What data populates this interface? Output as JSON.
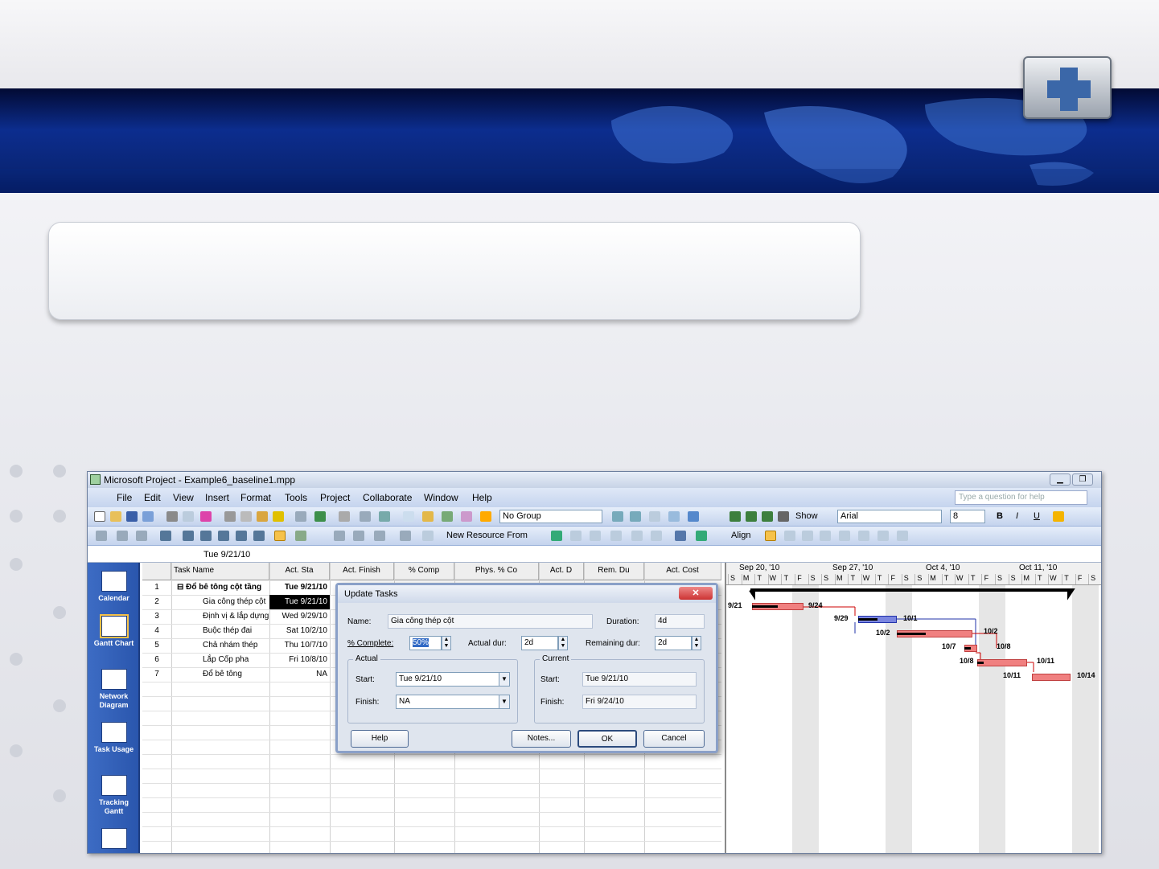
{
  "window": {
    "title": "Microsoft Project - Example6_baseline1.mpp"
  },
  "menu": [
    "File",
    "Edit",
    "View",
    "Insert",
    "Format",
    "Tools",
    "Project",
    "Collaborate",
    "Window",
    "Help"
  ],
  "help_search": {
    "placeholder": "Type a question for help"
  },
  "toolbar1": {
    "group_combo": "No Group",
    "show_label": "Show",
    "font_combo": "Arial",
    "size_combo": "8",
    "bold": "B",
    "italic": "I",
    "underline": "U"
  },
  "toolbar2": {
    "new_resource": "New Resource From",
    "align": "Align"
  },
  "edit_bar": {
    "value": "Tue 9/21/10"
  },
  "view_bar": [
    {
      "label": "Calendar"
    },
    {
      "label": "Gantt Chart"
    },
    {
      "label": "Network Diagram"
    },
    {
      "label": "Task Usage"
    },
    {
      "label": "Tracking Gantt"
    }
  ],
  "table": {
    "columns": [
      "Task Name",
      "Act. Sta",
      "Act. Finish",
      "% Comp",
      "Phys. % Co",
      "Act. D",
      "Rem. Du",
      "Act. Cost"
    ],
    "rows": [
      {
        "id": "1",
        "name": "Đổ bê tông cột tầng",
        "start": "Tue 9/21/10"
      },
      {
        "id": "2",
        "name": "Gia công thép cột",
        "start": "Tue 9/21/10"
      },
      {
        "id": "3",
        "name": "Định vị & lắp dựng",
        "start": "Wed 9/29/10"
      },
      {
        "id": "4",
        "name": "Buộc thép đai",
        "start": "Sat 10/2/10"
      },
      {
        "id": "5",
        "name": "Chả nhám thép",
        "start": "Thu 10/7/10"
      },
      {
        "id": "6",
        "name": "Lắp Cốp pha",
        "start": "Fri 10/8/10"
      },
      {
        "id": "7",
        "name": "Đổ bê tông",
        "start": "NA"
      }
    ]
  },
  "gantt": {
    "weeks": [
      "Sep 20, '10",
      "Sep 27, '10",
      "Oct 4, '10",
      "Oct 11, '10"
    ],
    "days": [
      "S",
      "M",
      "T",
      "W",
      "T",
      "F",
      "S",
      "S",
      "M",
      "T",
      "W",
      "T",
      "F",
      "S",
      "S",
      "M",
      "T",
      "W",
      "T",
      "F",
      "S",
      "S",
      "M",
      "T",
      "W",
      "T",
      "F",
      "S"
    ],
    "labels": [
      "9/21",
      "9/24",
      "9/29",
      "10/1",
      "10/2",
      "10/2",
      "10/7",
      "10/8",
      "10/8",
      "10/11",
      "10/11",
      "10/14"
    ]
  },
  "dialog": {
    "title": "Update Tasks",
    "name_label": "Name:",
    "name_value": "Gia công thép cột",
    "duration_label": "Duration:",
    "duration_value": "4d",
    "complete_label": "% Complete:",
    "complete_value": "50%",
    "actual_dur_label": "Actual dur:",
    "actual_dur_value": "2d",
    "remaining_label": "Remaining dur:",
    "remaining_value": "2d",
    "actual_group": "Actual",
    "current_group": "Current",
    "start_label": "Start:",
    "finish_label": "Finish:",
    "actual_start": "Tue 9/21/10",
    "actual_finish": "NA",
    "current_start": "Tue 9/21/10",
    "current_finish": "Fri 9/24/10",
    "help_btn": "Help",
    "notes_btn": "Notes...",
    "ok_btn": "OK",
    "cancel_btn": "Cancel"
  }
}
